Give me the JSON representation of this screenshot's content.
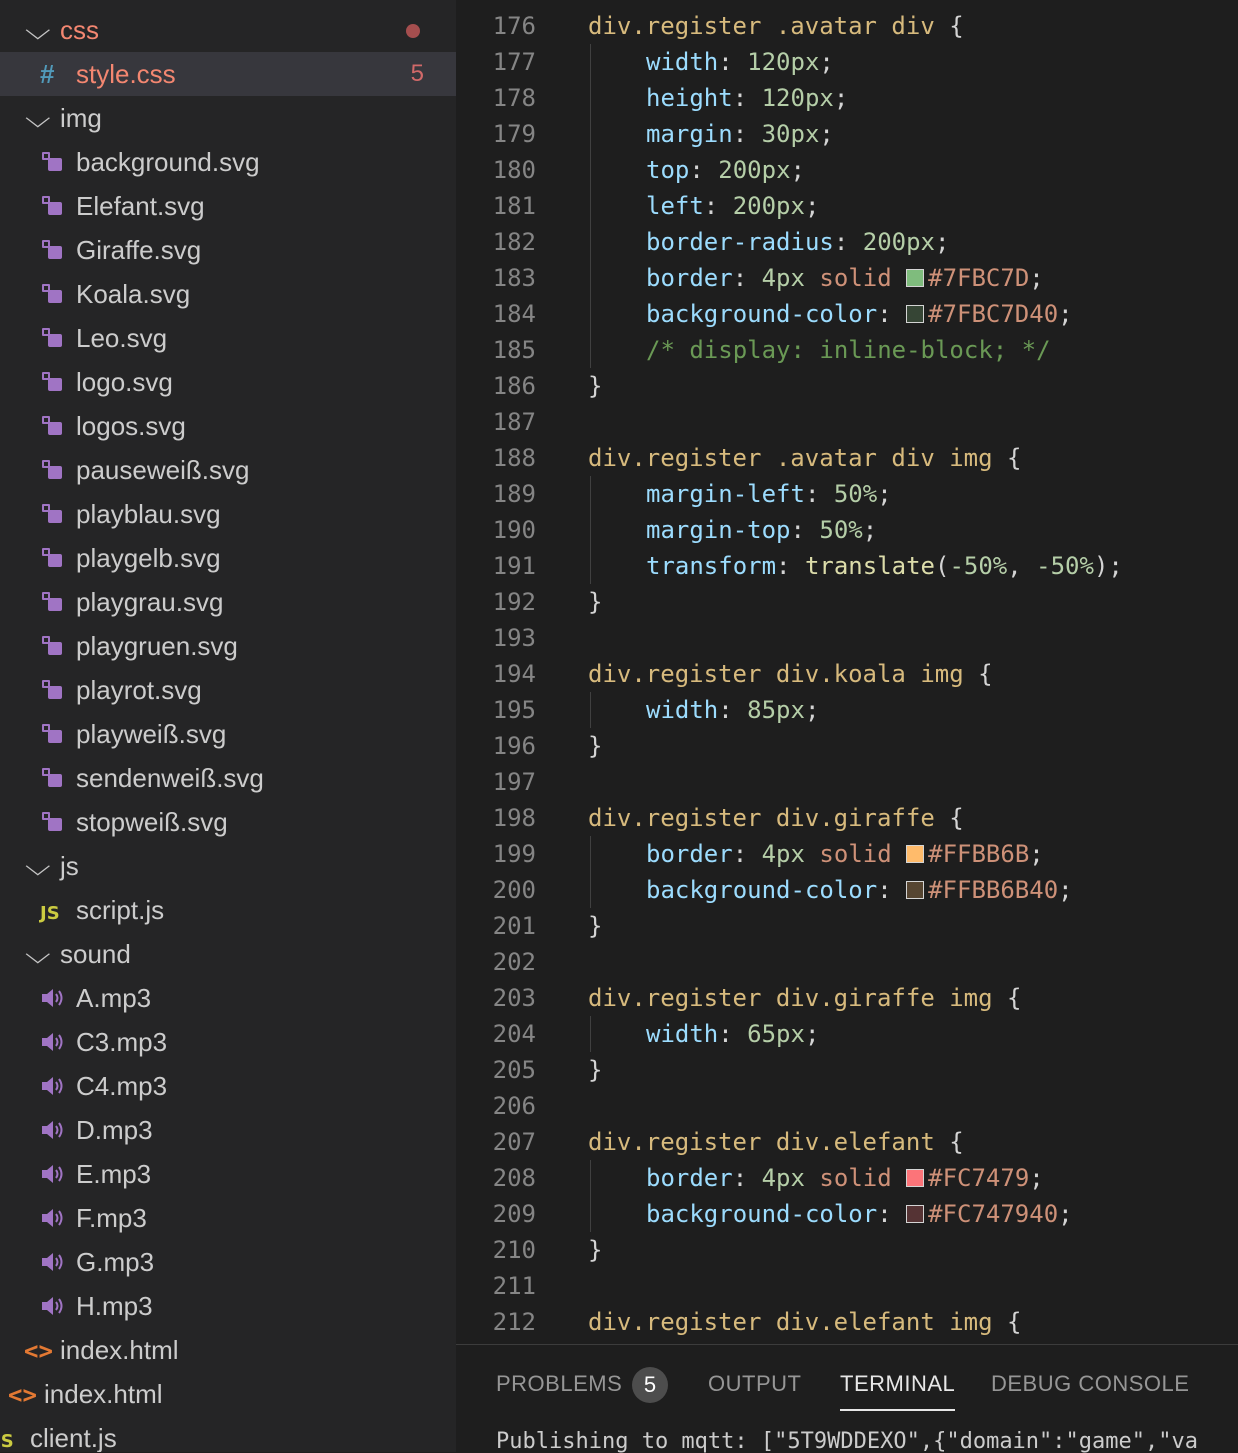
{
  "explorer": {
    "items": [
      {
        "kind": "folder",
        "label": "css",
        "indent": 0,
        "chevron": "⌵",
        "color": "#f48771",
        "modified": true
      },
      {
        "kind": "css",
        "label": "style.css",
        "indent": 1,
        "badge": "5",
        "selected": true,
        "color": "#f48771"
      },
      {
        "kind": "folder",
        "label": "img",
        "indent": 0,
        "chevron": "⌵"
      },
      {
        "kind": "svg",
        "label": "background.svg",
        "indent": 1
      },
      {
        "kind": "svg",
        "label": "Elefant.svg",
        "indent": 1
      },
      {
        "kind": "svg",
        "label": "Giraffe.svg",
        "indent": 1
      },
      {
        "kind": "svg",
        "label": "Koala.svg",
        "indent": 1
      },
      {
        "kind": "svg",
        "label": "Leo.svg",
        "indent": 1
      },
      {
        "kind": "svg",
        "label": "logo.svg",
        "indent": 1
      },
      {
        "kind": "svg",
        "label": "logos.svg",
        "indent": 1
      },
      {
        "kind": "svg",
        "label": "pauseweiß.svg",
        "indent": 1
      },
      {
        "kind": "svg",
        "label": "playblau.svg",
        "indent": 1
      },
      {
        "kind": "svg",
        "label": "playgelb.svg",
        "indent": 1
      },
      {
        "kind": "svg",
        "label": "playgrau.svg",
        "indent": 1
      },
      {
        "kind": "svg",
        "label": "playgruen.svg",
        "indent": 1
      },
      {
        "kind": "svg",
        "label": "playrot.svg",
        "indent": 1
      },
      {
        "kind": "svg",
        "label": "playweiß.svg",
        "indent": 1
      },
      {
        "kind": "svg",
        "label": "sendenweiß.svg",
        "indent": 1
      },
      {
        "kind": "svg",
        "label": "stopweiß.svg",
        "indent": 1
      },
      {
        "kind": "folder",
        "label": "js",
        "indent": 0,
        "chevron": "⌵"
      },
      {
        "kind": "js",
        "label": "script.js",
        "indent": 1
      },
      {
        "kind": "folder",
        "label": "sound",
        "indent": 0,
        "chevron": "⌵"
      },
      {
        "kind": "audio",
        "label": "A.mp3",
        "indent": 1
      },
      {
        "kind": "audio",
        "label": "C3.mp3",
        "indent": 1
      },
      {
        "kind": "audio",
        "label": "C4.mp3",
        "indent": 1
      },
      {
        "kind": "audio",
        "label": "D.mp3",
        "indent": 1
      },
      {
        "kind": "audio",
        "label": "E.mp3",
        "indent": 1
      },
      {
        "kind": "audio",
        "label": "F.mp3",
        "indent": 1
      },
      {
        "kind": "audio",
        "label": "G.mp3",
        "indent": 1
      },
      {
        "kind": "audio",
        "label": "H.mp3",
        "indent": 1
      },
      {
        "kind": "html",
        "label": "index.html",
        "indent": 0
      },
      {
        "kind": "html",
        "label": "index.html",
        "indent": -1
      },
      {
        "kind": "js",
        "label": "client.js",
        "indent": -2
      }
    ]
  },
  "editor": {
    "language": "css",
    "lines": [
      {
        "n": "176",
        "indent": 0,
        "tokens": [
          [
            "sel",
            "div.register .avatar div "
          ],
          [
            "punc",
            "{"
          ]
        ]
      },
      {
        "n": "177",
        "indent": 1,
        "tokens": [
          [
            "prop",
            "width"
          ],
          [
            "punc",
            ": "
          ],
          [
            "num",
            "120px"
          ],
          [
            "punc",
            ";"
          ]
        ]
      },
      {
        "n": "178",
        "indent": 1,
        "tokens": [
          [
            "prop",
            "height"
          ],
          [
            "punc",
            ": "
          ],
          [
            "num",
            "120px"
          ],
          [
            "punc",
            ";"
          ]
        ]
      },
      {
        "n": "179",
        "indent": 1,
        "tokens": [
          [
            "prop",
            "margin"
          ],
          [
            "punc",
            ": "
          ],
          [
            "num",
            "30px"
          ],
          [
            "punc",
            ";"
          ]
        ]
      },
      {
        "n": "180",
        "indent": 1,
        "tokens": [
          [
            "prop",
            "top"
          ],
          [
            "punc",
            ": "
          ],
          [
            "num",
            "200px"
          ],
          [
            "punc",
            ";"
          ]
        ]
      },
      {
        "n": "181",
        "indent": 1,
        "tokens": [
          [
            "prop",
            "left"
          ],
          [
            "punc",
            ": "
          ],
          [
            "num",
            "200px"
          ],
          [
            "punc",
            ";"
          ]
        ]
      },
      {
        "n": "182",
        "indent": 1,
        "tokens": [
          [
            "prop",
            "border-radius"
          ],
          [
            "punc",
            ": "
          ],
          [
            "num",
            "200px"
          ],
          [
            "punc",
            ";"
          ]
        ]
      },
      {
        "n": "183",
        "indent": 1,
        "tokens": [
          [
            "prop",
            "border"
          ],
          [
            "punc",
            ": "
          ],
          [
            "num",
            "4px"
          ],
          [
            "punc",
            " "
          ],
          [
            "str",
            "solid "
          ],
          [
            "swatch",
            "#7FBC7D"
          ],
          [
            "str",
            "#7FBC7D"
          ],
          [
            "punc",
            ";"
          ]
        ]
      },
      {
        "n": "184",
        "indent": 1,
        "tokens": [
          [
            "prop",
            "background-color"
          ],
          [
            "punc",
            ": "
          ],
          [
            "swatch",
            "#7FBC7D40"
          ],
          [
            "str",
            "#7FBC7D40"
          ],
          [
            "punc",
            ";"
          ]
        ]
      },
      {
        "n": "185",
        "indent": 1,
        "tokens": [
          [
            "com",
            "/* display: inline-block; */"
          ]
        ]
      },
      {
        "n": "186",
        "indent": 0,
        "tokens": [
          [
            "punc",
            "}"
          ]
        ]
      },
      {
        "n": "187",
        "indent": 0,
        "tokens": []
      },
      {
        "n": "188",
        "indent": 0,
        "tokens": [
          [
            "sel",
            "div.register .avatar div img "
          ],
          [
            "punc",
            "{"
          ]
        ]
      },
      {
        "n": "189",
        "indent": 1,
        "tokens": [
          [
            "prop",
            "margin-left"
          ],
          [
            "punc",
            ": "
          ],
          [
            "num",
            "50%"
          ],
          [
            "punc",
            ";"
          ]
        ]
      },
      {
        "n": "190",
        "indent": 1,
        "tokens": [
          [
            "prop",
            "margin-top"
          ],
          [
            "punc",
            ": "
          ],
          [
            "num",
            "50%"
          ],
          [
            "punc",
            ";"
          ]
        ]
      },
      {
        "n": "191",
        "indent": 1,
        "tokens": [
          [
            "prop",
            "transform"
          ],
          [
            "punc",
            ": "
          ],
          [
            "fn",
            "translate"
          ],
          [
            "punc",
            "("
          ],
          [
            "num",
            "-50%"
          ],
          [
            "punc",
            ", "
          ],
          [
            "num",
            "-50%"
          ],
          [
            "punc",
            ");"
          ]
        ]
      },
      {
        "n": "192",
        "indent": 0,
        "tokens": [
          [
            "punc",
            "}"
          ]
        ]
      },
      {
        "n": "193",
        "indent": 0,
        "tokens": []
      },
      {
        "n": "194",
        "indent": 0,
        "tokens": [
          [
            "sel",
            "div.register div.koala img "
          ],
          [
            "punc",
            "{"
          ]
        ]
      },
      {
        "n": "195",
        "indent": 1,
        "tokens": [
          [
            "prop",
            "width"
          ],
          [
            "punc",
            ": "
          ],
          [
            "num",
            "85px"
          ],
          [
            "punc",
            ";"
          ]
        ]
      },
      {
        "n": "196",
        "indent": 0,
        "tokens": [
          [
            "punc",
            "}"
          ]
        ]
      },
      {
        "n": "197",
        "indent": 0,
        "tokens": []
      },
      {
        "n": "198",
        "indent": 0,
        "tokens": [
          [
            "sel",
            "div.register div.giraffe "
          ],
          [
            "punc",
            "{"
          ]
        ]
      },
      {
        "n": "199",
        "indent": 1,
        "tokens": [
          [
            "prop",
            "border"
          ],
          [
            "punc",
            ": "
          ],
          [
            "num",
            "4px"
          ],
          [
            "punc",
            " "
          ],
          [
            "str",
            "solid "
          ],
          [
            "swatch",
            "#FFBB6B"
          ],
          [
            "str",
            "#FFBB6B"
          ],
          [
            "punc",
            ";"
          ]
        ]
      },
      {
        "n": "200",
        "indent": 1,
        "tokens": [
          [
            "prop",
            "background-color"
          ],
          [
            "punc",
            ": "
          ],
          [
            "swatch",
            "#FFBB6B40"
          ],
          [
            "str",
            "#FFBB6B40"
          ],
          [
            "punc",
            ";"
          ]
        ]
      },
      {
        "n": "201",
        "indent": 0,
        "tokens": [
          [
            "punc",
            "}"
          ]
        ]
      },
      {
        "n": "202",
        "indent": 0,
        "tokens": []
      },
      {
        "n": "203",
        "indent": 0,
        "tokens": [
          [
            "sel",
            "div.register div.giraffe img "
          ],
          [
            "punc",
            "{"
          ]
        ]
      },
      {
        "n": "204",
        "indent": 1,
        "tokens": [
          [
            "prop",
            "width"
          ],
          [
            "punc",
            ": "
          ],
          [
            "num",
            "65px"
          ],
          [
            "punc",
            ";"
          ]
        ]
      },
      {
        "n": "205",
        "indent": 0,
        "tokens": [
          [
            "punc",
            "}"
          ]
        ]
      },
      {
        "n": "206",
        "indent": 0,
        "tokens": []
      },
      {
        "n": "207",
        "indent": 0,
        "tokens": [
          [
            "sel",
            "div.register div.elefant "
          ],
          [
            "punc",
            "{"
          ]
        ]
      },
      {
        "n": "208",
        "indent": 1,
        "tokens": [
          [
            "prop",
            "border"
          ],
          [
            "punc",
            ": "
          ],
          [
            "num",
            "4px"
          ],
          [
            "punc",
            " "
          ],
          [
            "str",
            "solid "
          ],
          [
            "swatch",
            "#FC7479"
          ],
          [
            "str",
            "#FC7479"
          ],
          [
            "punc",
            ";"
          ]
        ]
      },
      {
        "n": "209",
        "indent": 1,
        "tokens": [
          [
            "prop",
            "background-color"
          ],
          [
            "punc",
            ": "
          ],
          [
            "swatch",
            "#FC747940"
          ],
          [
            "str",
            "#FC747940"
          ],
          [
            "punc",
            ";"
          ]
        ]
      },
      {
        "n": "210",
        "indent": 0,
        "tokens": [
          [
            "punc",
            "}"
          ]
        ]
      },
      {
        "n": "211",
        "indent": 0,
        "tokens": []
      },
      {
        "n": "212",
        "indent": 0,
        "tokens": [
          [
            "sel",
            "div.register div.elefant img "
          ],
          [
            "punc",
            "{"
          ]
        ]
      }
    ]
  },
  "panel": {
    "tabs": [
      {
        "label": "PROBLEMS",
        "badge": "5"
      },
      {
        "label": "OUTPUT"
      },
      {
        "label": "TERMINAL",
        "active": true
      },
      {
        "label": "DEBUG CONSOLE"
      }
    ],
    "terminal_text": "Publishing to mqtt: [\"5T9WDDEXO\",{\"domain\":\"game\",\"va"
  },
  "colors": {
    "accent_modified": "#f48771",
    "svg_icon": "#a074c4",
    "audio_icon": "#a074c4",
    "html_icon": "#e37933",
    "js_icon": "#cbcb41",
    "css_icon": "#519aba"
  }
}
